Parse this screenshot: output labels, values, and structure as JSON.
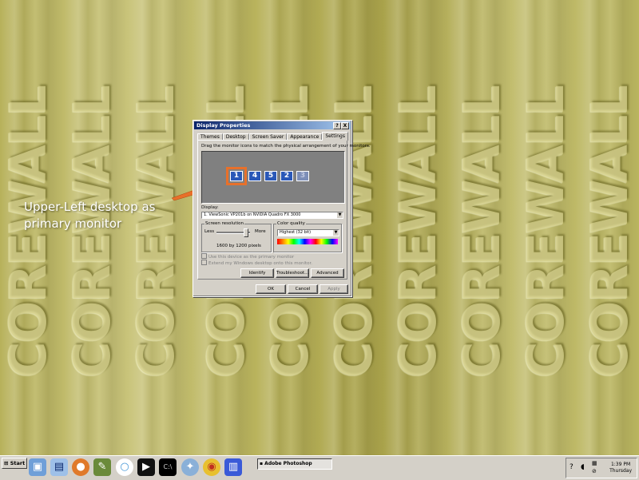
{
  "wallpaper": {
    "word": "COREWALL"
  },
  "dialog": {
    "title": "Display Properties",
    "help_label": "?",
    "close_label": "X",
    "tabs": [
      "Themes",
      "Desktop",
      "Screen Saver",
      "Appearance",
      "Settings"
    ],
    "active_tab": "Settings",
    "instruction": "Drag the monitor icons to match the physical arrangement of your monitors.",
    "monitors": [
      "1",
      "4",
      "5",
      "2",
      "3"
    ],
    "display_label": "Display:",
    "display_value": "1. ViewSonic VP201b on NVIDIA Quadro FX 3000",
    "resolution_title": "Screen resolution",
    "less_label": "Less",
    "more_label": "More",
    "resolution_value": "1600 by 1200 pixels",
    "color_title": "Color quality",
    "color_value": "Highest (32 bit)",
    "check_primary": "Use this device as the primary monitor",
    "check_extend": "Extend my Windows desktop onto this monitor.",
    "identify_label": "Identify",
    "troubleshoot_label": "Troubleshoot...",
    "advanced_label": "Advanced",
    "ok_label": "OK",
    "cancel_label": "Cancel",
    "apply_label": "Apply"
  },
  "annotation": {
    "line1": "Upper-Left desktop as",
    "line2": "primary monitor",
    "color": "#e8702a"
  },
  "taskbar": {
    "start_label": "Start",
    "task_label": "Adobe Photoshop",
    "time": "1:39 PM",
    "day": "Thursday"
  }
}
